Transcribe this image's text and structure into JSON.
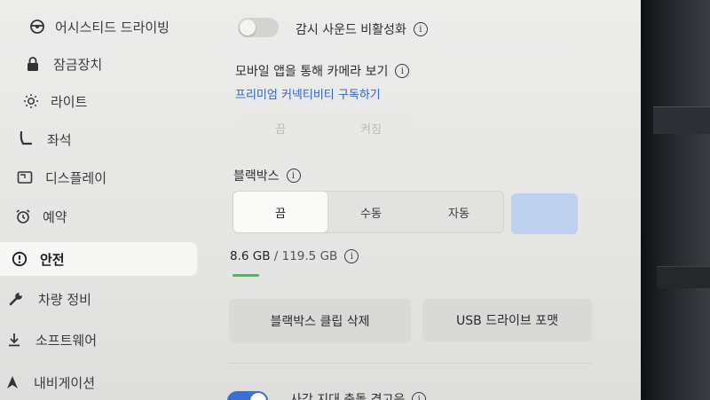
{
  "sidebar": {
    "items": [
      {
        "label": "어시스티드 드라이빙",
        "icon": "steering-wheel-icon"
      },
      {
        "label": "잠금장치",
        "icon": "lock-icon"
      },
      {
        "label": "라이트",
        "icon": "sun-icon"
      },
      {
        "label": "좌석",
        "icon": "seat-icon"
      },
      {
        "label": "디스플레이",
        "icon": "display-icon"
      },
      {
        "label": "예약",
        "icon": "alarm-clock-icon"
      },
      {
        "label": "안전",
        "icon": "alert-circle-icon",
        "active": true
      },
      {
        "label": "차량 정비",
        "icon": "wrench-icon"
      },
      {
        "label": "소프트웨어",
        "icon": "download-icon"
      },
      {
        "label": "내비게이션",
        "icon": "navigation-icon"
      }
    ]
  },
  "safety": {
    "sentry_sound_disable": {
      "label": "감시 사운드 비활성화",
      "enabled": false
    },
    "mobile_camera": {
      "label": "모바일 앱을 통해 카메라 보기",
      "link": "프리미엄 커넥티비티 구독하기",
      "options": [
        "끔",
        "켜짐"
      ]
    },
    "dashcam": {
      "label": "블랙박스",
      "options": [
        "끔",
        "수동",
        "자동"
      ],
      "selected": "끔",
      "save_button": ""
    },
    "storage": {
      "used": "8.6 GB",
      "separator": " / ",
      "total": "119.5 GB",
      "fraction": 0.072
    },
    "buttons": {
      "delete_clips": "블랙박스 클립 삭제",
      "format_usb": "USB 드라이브 포맷"
    },
    "bottom_toggle": {
      "label": "사각 지대 충돌 경고음",
      "enabled": true
    }
  },
  "colors": {
    "accent": "#3b6fd4",
    "storage_bar": "#3fbf5a",
    "link": "#2e63c8"
  }
}
